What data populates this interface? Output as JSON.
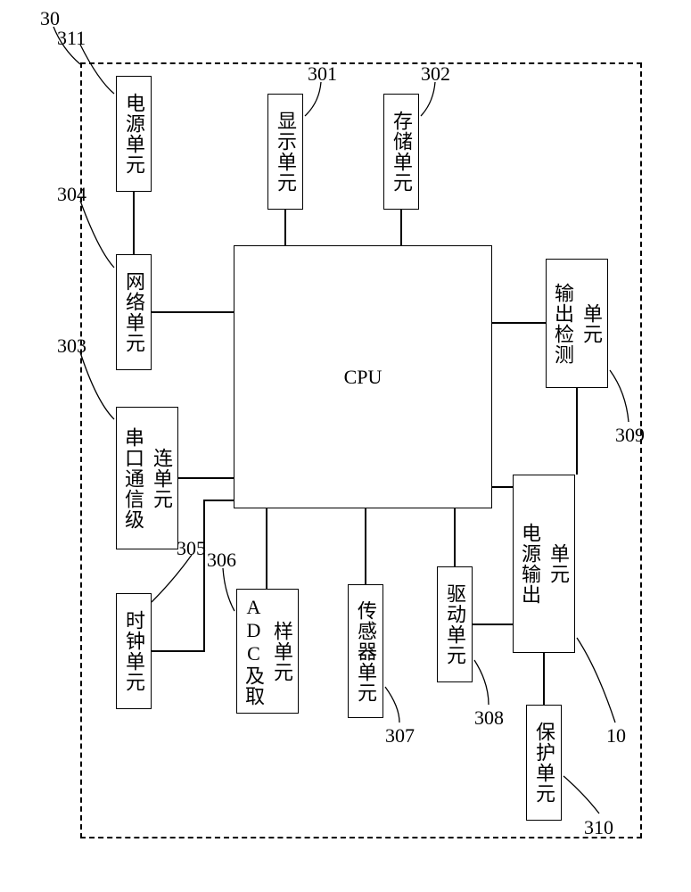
{
  "refs": {
    "main": "30",
    "display": "301",
    "storage": "302",
    "serial": "303",
    "network": "304",
    "clock": "305",
    "adc": "306",
    "sensor": "307",
    "drive": "308",
    "output_detect": "309",
    "protect": "310",
    "power_in": "311",
    "power_out": "10"
  },
  "blocks": {
    "cpu": "CPU",
    "display": "显示单元",
    "storage": "存储单元",
    "power_in": "电源单元",
    "network": "网络单元",
    "serial_l1": "串口通信级",
    "serial_l2": "连单元",
    "clock": "时钟单元",
    "adc_l1": "ADC及取",
    "adc_l2": "样单元",
    "sensor": "传感器单元",
    "drive": "驱动单元",
    "output_detect_l1": "输出检测",
    "output_detect_l2": "单元",
    "power_out_l1": "电源输出",
    "power_out_l2": "单元",
    "protect": "保护单元"
  }
}
